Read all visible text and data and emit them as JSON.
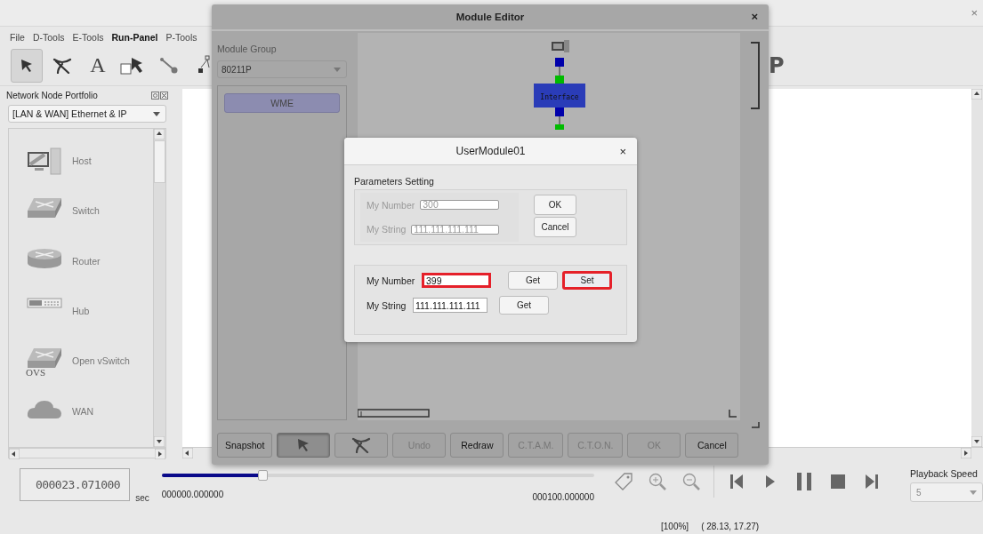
{
  "main_window": {
    "close": "×"
  },
  "menu": [
    {
      "label": "File"
    },
    {
      "label": "D-Tools"
    },
    {
      "label": "E-Tools"
    },
    {
      "label": "Run-Panel",
      "bold": true
    },
    {
      "label": "P-Tools"
    }
  ],
  "toolbar": [
    {
      "kind": "pointer",
      "selected": true
    },
    {
      "kind": "cut",
      "selected": false
    },
    {
      "kind": "text",
      "label": "A",
      "selected": false
    },
    {
      "kind": "rect-select",
      "selected": false
    },
    {
      "kind": "link",
      "selected": false
    },
    {
      "kind": "tree",
      "selected": false
    },
    {
      "kind": "letter",
      "label": "P",
      "selected": false
    }
  ],
  "portfolio": {
    "title": "Network Node Portfolio",
    "category": "[LAN & WAN] Ethernet & IP",
    "nodes": [
      {
        "label": "Host",
        "kind": "host"
      },
      {
        "label": "Switch",
        "kind": "switch"
      },
      {
        "label": "Router",
        "kind": "router"
      },
      {
        "label": "Hub",
        "kind": "hub"
      },
      {
        "label": "Open vSwitch",
        "kind": "ovs",
        "badge": "OVS"
      },
      {
        "label": "WAN",
        "kind": "wan"
      }
    ]
  },
  "timeline": {
    "clock": "000023.071000",
    "unit": "sec",
    "level": 0.235,
    "start": "000000.000000",
    "end": "000100.000000"
  },
  "playback": {
    "label": "Playback Speed",
    "value": "5"
  },
  "status_bar": {
    "zoom": "[100%]",
    "coords": "( 28.13, 17.27)"
  },
  "module_editor": {
    "title": "Module Editor",
    "close": "×",
    "group_label": "Module Group",
    "group_value": "80211P",
    "modules": [
      {
        "label": "WME",
        "selected": true
      }
    ],
    "diagram": {
      "node_label": "Interface"
    },
    "buttons": [
      {
        "kind": "text",
        "label": "Snapshot",
        "disabled": false,
        "pressed": false
      },
      {
        "kind": "pointer",
        "disabled": false,
        "pressed": true
      },
      {
        "kind": "cut",
        "disabled": false,
        "pressed": false
      },
      {
        "kind": "text",
        "label": "Undo",
        "disabled": true,
        "pressed": false
      },
      {
        "kind": "text",
        "label": "Redraw",
        "disabled": false,
        "pressed": false
      },
      {
        "kind": "text",
        "label": "C.T.A.M.",
        "disabled": true,
        "pressed": false
      },
      {
        "kind": "text",
        "label": "C.T.O.N.",
        "disabled": true,
        "pressed": false
      },
      {
        "kind": "text",
        "label": "OK",
        "disabled": true,
        "pressed": false
      },
      {
        "kind": "text",
        "label": "Cancel",
        "disabled": false,
        "pressed": false
      }
    ]
  },
  "user_module": {
    "title": "UserModule01",
    "close": "×",
    "section": "Parameters Setting",
    "params": [
      {
        "label": "My Number",
        "value": "300"
      },
      {
        "label": "My String",
        "value": "111.111.111.111"
      }
    ],
    "ok": "OK",
    "cancel": "Cancel",
    "live": [
      {
        "label": "My Number",
        "value": "399",
        "highlighted": true,
        "buttons": [
          {
            "label": "Get",
            "highlighted": false
          },
          {
            "label": "Set",
            "highlighted": true
          }
        ]
      },
      {
        "label": "My String",
        "value": "111.111.111.111",
        "highlighted": false,
        "buttons": [
          {
            "label": "Get",
            "highlighted": false
          }
        ]
      }
    ]
  }
}
